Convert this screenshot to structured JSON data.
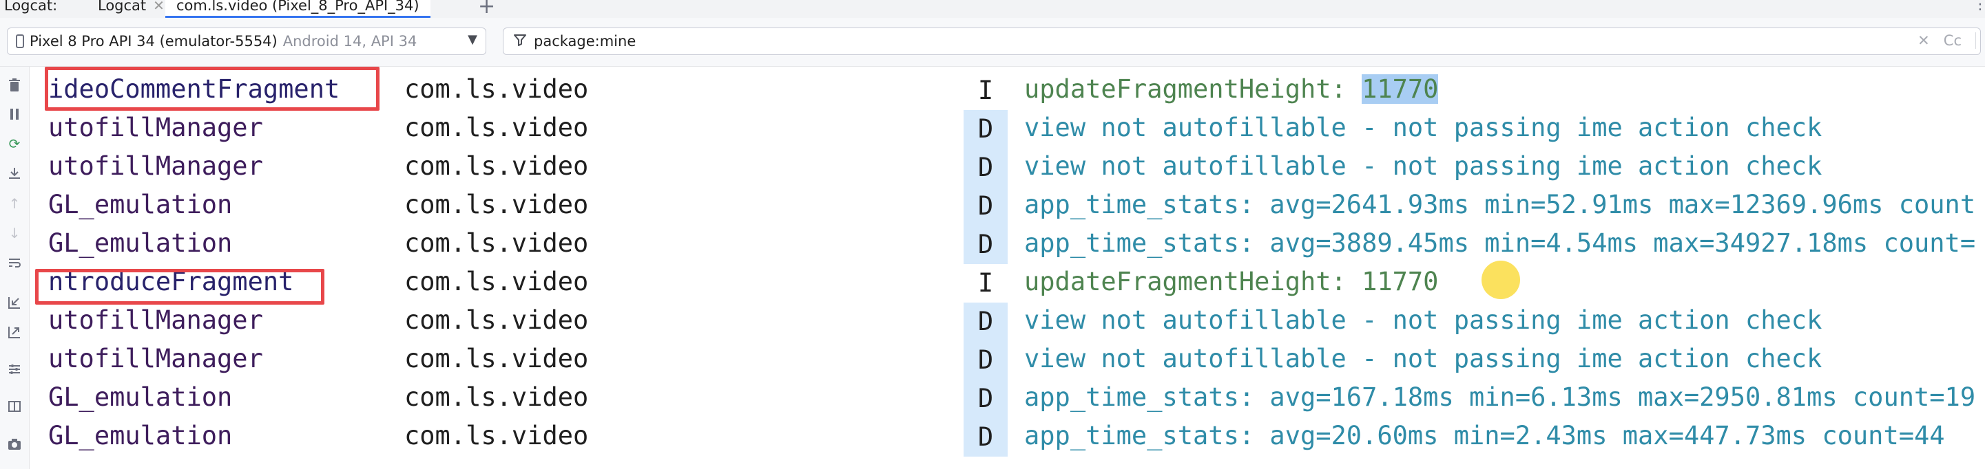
{
  "tabbar": {
    "window_title": "Logcat:",
    "tabs": [
      {
        "label": "Logcat"
      },
      {
        "label": "com.ls.video (Pixel_8_Pro_API_34)"
      }
    ],
    "add_tab": "+",
    "overflow": "⋮"
  },
  "filterbar": {
    "device": {
      "name": "Pixel 8 Pro API 34 (emulator-5554)",
      "api": "Android 14, API 34"
    },
    "filter": {
      "value": "package:mine",
      "clear": "✕",
      "match_case": "Cc"
    }
  },
  "colors": {
    "debug_message": "#2f8ca8",
    "info_message": "#4e8450",
    "debug_level_bg": "#d6e9fb",
    "selection": "#a8cdf3",
    "highlight_box": "#e8474a",
    "click_indicator": "#fad728"
  },
  "icons": [
    "trash-icon",
    "pause-icon",
    "restart-icon",
    "scroll-to-end-icon",
    "up-arrow-icon",
    "down-arrow-icon",
    "soft-wrap-icon",
    "import-icon",
    "export-icon",
    "settings-icon",
    "split-panels-icon",
    "screenshot-icon"
  ],
  "log": {
    "rows": [
      {
        "tag": "ideoCommentFragment",
        "package": "com.ls.video",
        "level": "I",
        "message_prefix": "updateFragmentHeight: ",
        "message_value": "11770",
        "kind": "info"
      },
      {
        "tag": "utofillManager",
        "package": "com.ls.video",
        "level": "D",
        "message_prefix": "view not autofillable - not passing ime action check",
        "message_value": "",
        "kind": "debug"
      },
      {
        "tag": "utofillManager",
        "package": "com.ls.video",
        "level": "D",
        "message_prefix": "view not autofillable - not passing ime action check",
        "message_value": "",
        "kind": "debug"
      },
      {
        "tag": "GL_emulation",
        "package": "com.ls.video",
        "level": "D",
        "message_prefix": "app_time_stats: avg=2641.93ms min=52.91ms max=12369.96ms count",
        "message_value": "",
        "kind": "debug"
      },
      {
        "tag": "GL_emulation",
        "package": "com.ls.video",
        "level": "D",
        "message_prefix": "app_time_stats: avg=3889.45ms min=4.54ms max=34927.18ms count=",
        "message_value": "",
        "kind": "debug"
      },
      {
        "tag": "ntroduceFragment",
        "package": "com.ls.video",
        "level": "I",
        "message_prefix": "updateFragmentHeight: 11770",
        "message_value": "",
        "kind": "info"
      },
      {
        "tag": "utofillManager",
        "package": "com.ls.video",
        "level": "D",
        "message_prefix": "view not autofillable - not passing ime action check",
        "message_value": "",
        "kind": "debug"
      },
      {
        "tag": "utofillManager",
        "package": "com.ls.video",
        "level": "D",
        "message_prefix": "view not autofillable - not passing ime action check",
        "message_value": "",
        "kind": "debug"
      },
      {
        "tag": "GL_emulation",
        "package": "com.ls.video",
        "level": "D",
        "message_prefix": "app_time_stats: avg=167.18ms min=6.13ms max=2950.81ms count=19",
        "message_value": "",
        "kind": "debug"
      },
      {
        "tag": "GL_emulation",
        "package": "com.ls.video",
        "level": "D",
        "message_prefix": "app_time_stats: avg=20.60ms min=2.43ms max=447.73ms count=44",
        "message_value": "",
        "kind": "debug"
      }
    ]
  }
}
